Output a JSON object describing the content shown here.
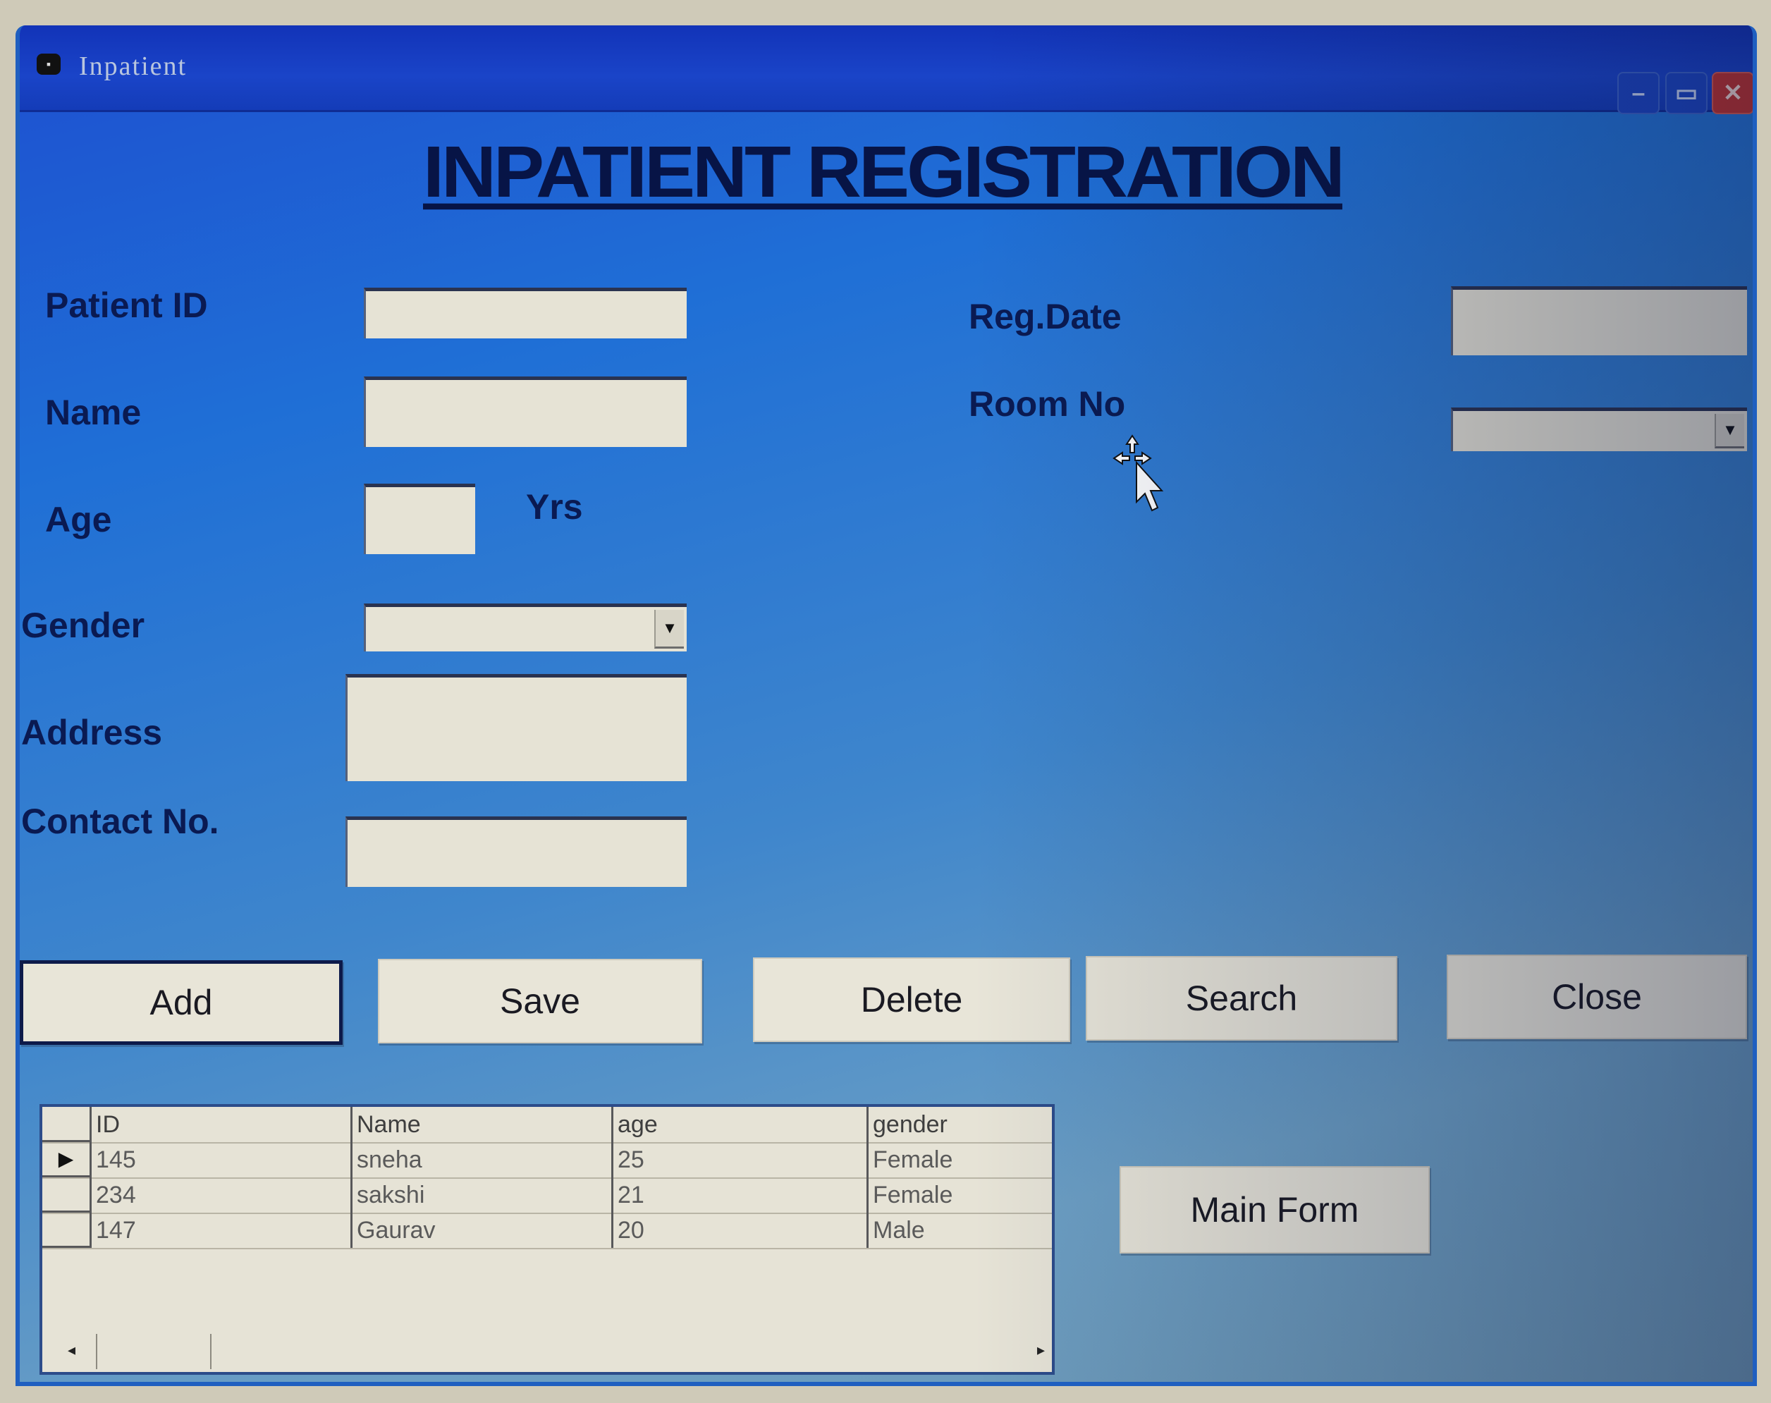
{
  "window": {
    "title": "Inpatient",
    "controls": {
      "minimize": "–",
      "maximize": "▭",
      "close": "✕"
    }
  },
  "heading": "INPATIENT REGISTRATION",
  "form": {
    "patient_id": {
      "label": "Patient ID",
      "value": ""
    },
    "name": {
      "label": "Name",
      "value": ""
    },
    "age": {
      "label": "Age",
      "value": "",
      "unit": "Yrs"
    },
    "gender": {
      "label": "Gender",
      "selected": ""
    },
    "address": {
      "label": "Address",
      "value": ""
    },
    "contact_no": {
      "label": "Contact No.",
      "value": ""
    },
    "reg_date": {
      "label": "Reg.Date",
      "value": ""
    },
    "room_no": {
      "label": "Room No",
      "selected": ""
    }
  },
  "buttons": {
    "add": "Add",
    "save": "Save",
    "delete": "Delete",
    "search": "Search",
    "close": "Close",
    "main_form": "Main Form"
  },
  "grid": {
    "columns": [
      "ID",
      "Name",
      "age",
      "gender"
    ],
    "rows": [
      {
        "id": "145",
        "name": "sneha",
        "age": "25",
        "gender": "Female",
        "current": true
      },
      {
        "id": "234",
        "name": "sakshi",
        "age": "21",
        "gender": "Female",
        "current": false
      },
      {
        "id": "147",
        "name": "Gaurav",
        "age": "20",
        "gender": "Male",
        "current": false
      }
    ],
    "current_row_marker": "▶",
    "scroll_left": "◂",
    "scroll_right": "▸"
  },
  "icons": {
    "app": "▪",
    "dropdown": "▼"
  },
  "colors": {
    "form_bg_top": "#1e4fd0",
    "form_bg_bottom": "#6e98b4",
    "titlebar": "#1a44c8",
    "close_button": "#c0322e",
    "label_text": "#0a1a52",
    "field_bg": "#e6e3d5"
  }
}
